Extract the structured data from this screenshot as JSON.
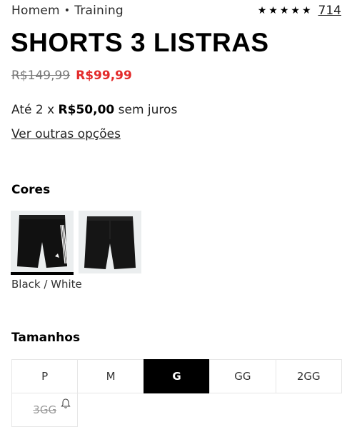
{
  "breadcrumb": {
    "category": "Homem",
    "separator": "•",
    "subcategory": "Training"
  },
  "rating": {
    "stars": [
      "★",
      "★",
      "★",
      "★",
      "★"
    ],
    "count": "714"
  },
  "product": {
    "title": "SHORTS 3 LISTRAS"
  },
  "price": {
    "original": "R$149,99",
    "sale": "R$99,99",
    "sale_color": "#e32b2b"
  },
  "installments": {
    "prefix": "Até 2 x",
    "amount": "R$50,00",
    "suffix": "sem juros"
  },
  "other_options": "Ver outras opções",
  "colors": {
    "heading": "Cores",
    "selected_name": "Black / White",
    "swatches": [
      "black-white",
      "black"
    ]
  },
  "sizes": {
    "heading": "Tamanhos",
    "options": [
      "P",
      "M",
      "G",
      "GG",
      "2GG",
      "3GG"
    ],
    "selected": "G",
    "unavailable": [
      "3GG"
    ]
  }
}
